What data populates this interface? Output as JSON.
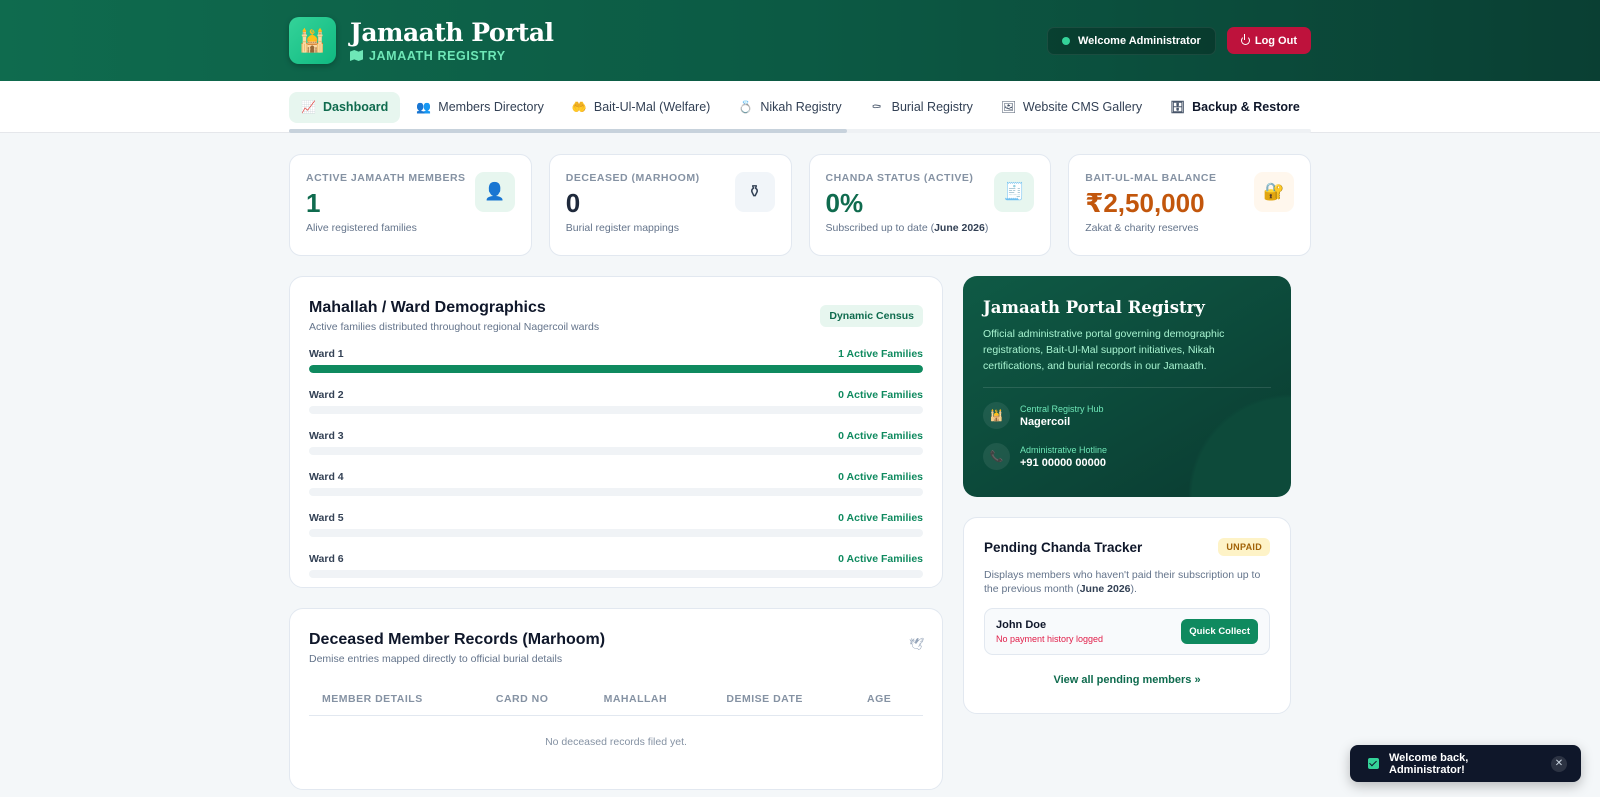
{
  "header": {
    "title": "Jamaath Portal",
    "subtitle": "JAMAATH REGISTRY",
    "logo_icon": "mosque-icon",
    "welcome": "Welcome Administrator",
    "logout": "Log Out"
  },
  "nav": {
    "items": [
      {
        "label": "Dashboard",
        "icon": "chart-line-icon"
      },
      {
        "label": "Members Directory",
        "icon": "users-icon"
      },
      {
        "label": "Bait-Ul-Mal (Welfare)",
        "icon": "hand-coins-icon"
      },
      {
        "label": "Nikah Registry",
        "icon": "ring-icon"
      },
      {
        "label": "Burial Registry",
        "icon": "tombstone-icon"
      },
      {
        "label": "Website CMS Gallery",
        "icon": "images-icon"
      },
      {
        "label": "Backup & Restore",
        "icon": "database-icon"
      }
    ]
  },
  "stats": [
    {
      "label": "ACTIVE JAMAATH MEMBERS",
      "value": "1",
      "note": "Alive registered families"
    },
    {
      "label": "DECEASED (MARHOOM)",
      "value": "0",
      "note": "Burial register mappings"
    },
    {
      "label": "CHANDA STATUS (ACTIVE)",
      "value": "0%",
      "note_pre": "Subscribed up to date (",
      "note_bold": "June 2026",
      "note_post": ")"
    },
    {
      "label": "BAIT-UL-MAL BALANCE",
      "value": "₹2,50,000",
      "note": "Zakat & charity reserves"
    }
  ],
  "demographics": {
    "title": "Mahallah / Ward Demographics",
    "subtitle": "Active families distributed throughout regional Nagercoil wards",
    "badge": "Dynamic Census",
    "wards": [
      {
        "name": "Ward 1",
        "count": "1 Active Families",
        "fill": 1.0
      },
      {
        "name": "Ward 2",
        "count": "0 Active Families",
        "fill": 0
      },
      {
        "name": "Ward 3",
        "count": "0 Active Families",
        "fill": 0
      },
      {
        "name": "Ward 4",
        "count": "0 Active Families",
        "fill": 0
      },
      {
        "name": "Ward 5",
        "count": "0 Active Families",
        "fill": 0
      },
      {
        "name": "Ward 6",
        "count": "0 Active Families",
        "fill": 0
      }
    ]
  },
  "deceased": {
    "title": "Deceased Member Records (Marhoom)",
    "subtitle": "Demise entries mapped directly to official burial details",
    "columns": [
      "MEMBER DETAILS",
      "CARD NO",
      "MAHALLAH",
      "DEMISE DATE",
      "AGE"
    ],
    "empty": "No deceased records filed yet."
  },
  "info": {
    "title": "Jamaath Portal Registry",
    "description": "Official administrative portal governing demographic registrations, Bait-Ul-Mal support initiatives, Nikah certifications, and burial records in our Jamaath.",
    "hub_label": "Central Registry Hub",
    "hub_value": "Nagercoil",
    "hotline_label": "Administrative Hotline",
    "hotline_value": "+91 00000 00000"
  },
  "pending": {
    "title": "Pending Chanda Tracker",
    "badge": "UNPAID",
    "desc_pre": "Displays members who haven't paid their subscription up to the previous month (",
    "desc_bold": "June 2026",
    "desc_post": ").",
    "member_name": "John Doe",
    "member_status": "No payment history logged",
    "collect": "Quick Collect",
    "view_all": "View all pending members »"
  },
  "toast": {
    "message": "Welcome back, Administrator!"
  },
  "colors": {
    "primary": "#0f6b4e",
    "accent": "#0f8a5f",
    "danger": "#be123c",
    "orange": "#c2560c"
  }
}
